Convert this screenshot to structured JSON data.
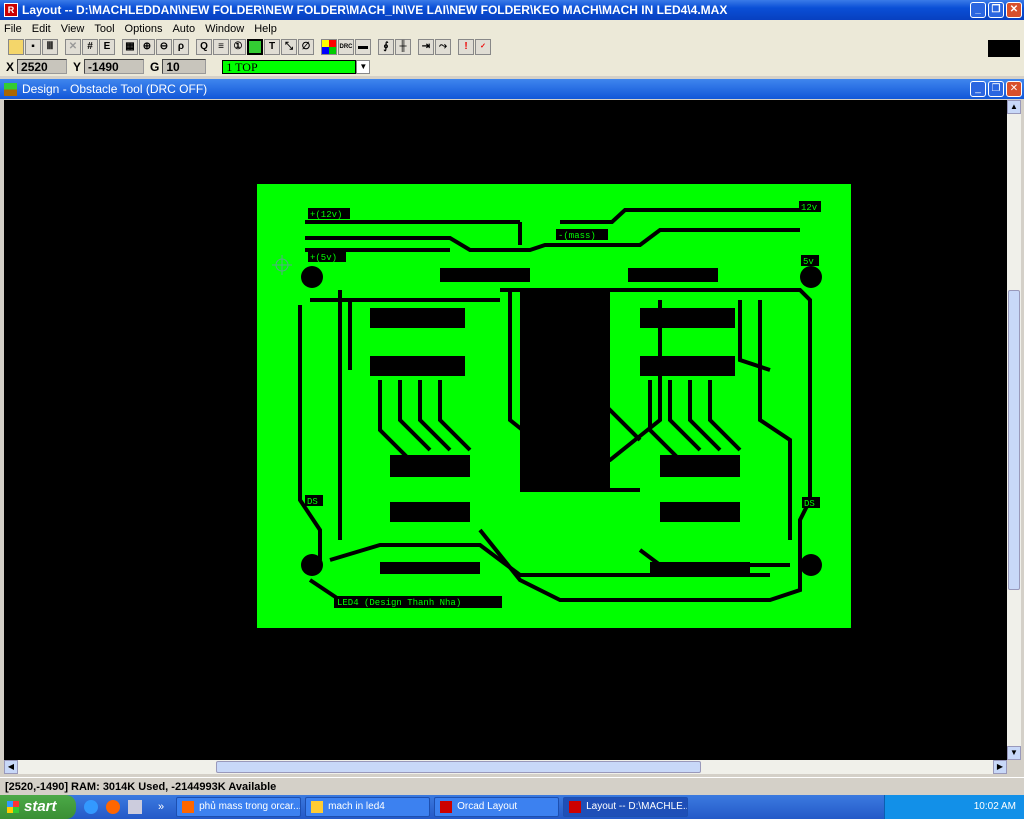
{
  "window": {
    "title": "Layout -- D:\\MACHLEDDAN\\NEW FOLDER\\NEW FOLDER\\MACH_IN\\VE LAI\\NEW FOLDER\\KEO MACH\\MACH IN LED4\\4.MAX"
  },
  "menu": [
    "File",
    "Edit",
    "View",
    "Tool",
    "Options",
    "Auto",
    "Window",
    "Help"
  ],
  "toolbar": {
    "buttons": [
      "open",
      "save",
      "library",
      "delete",
      "find",
      "E",
      "spreadsheet",
      "zoom-in",
      "zoom-out",
      "zoom-all",
      "query",
      "grid",
      "pin",
      "obstacle",
      "T",
      "connection",
      "error",
      "color",
      "drc",
      "component",
      "reconnect",
      "pin-swap",
      "auto-path",
      "route",
      "error-check",
      "drc-check"
    ]
  },
  "coords": {
    "x_label": "X",
    "x": "2520",
    "y_label": "Y",
    "y": "-1490",
    "g_label": "G",
    "g": "10",
    "layer": "1 TOP"
  },
  "child": {
    "title": "Design - Obstacle Tool (DRC OFF)"
  },
  "pcb": {
    "labels": [
      "+(12v)",
      "+(5v)",
      "-(mass)",
      "12v",
      "5v",
      "DS",
      "DS",
      "LED4 (Design Thanh Nha)"
    ],
    "board_color": "#00ff00"
  },
  "status": {
    "text": "[2520,-1490]   RAM: 3014K Used, -2144993K Available"
  },
  "taskbar": {
    "start": "start",
    "tasks": [
      "phủ mass trong orcar...",
      "mach in led4",
      "Orcad Layout",
      "Layout -- D:\\MACHLE..."
    ],
    "clock": "10:02 AM"
  }
}
